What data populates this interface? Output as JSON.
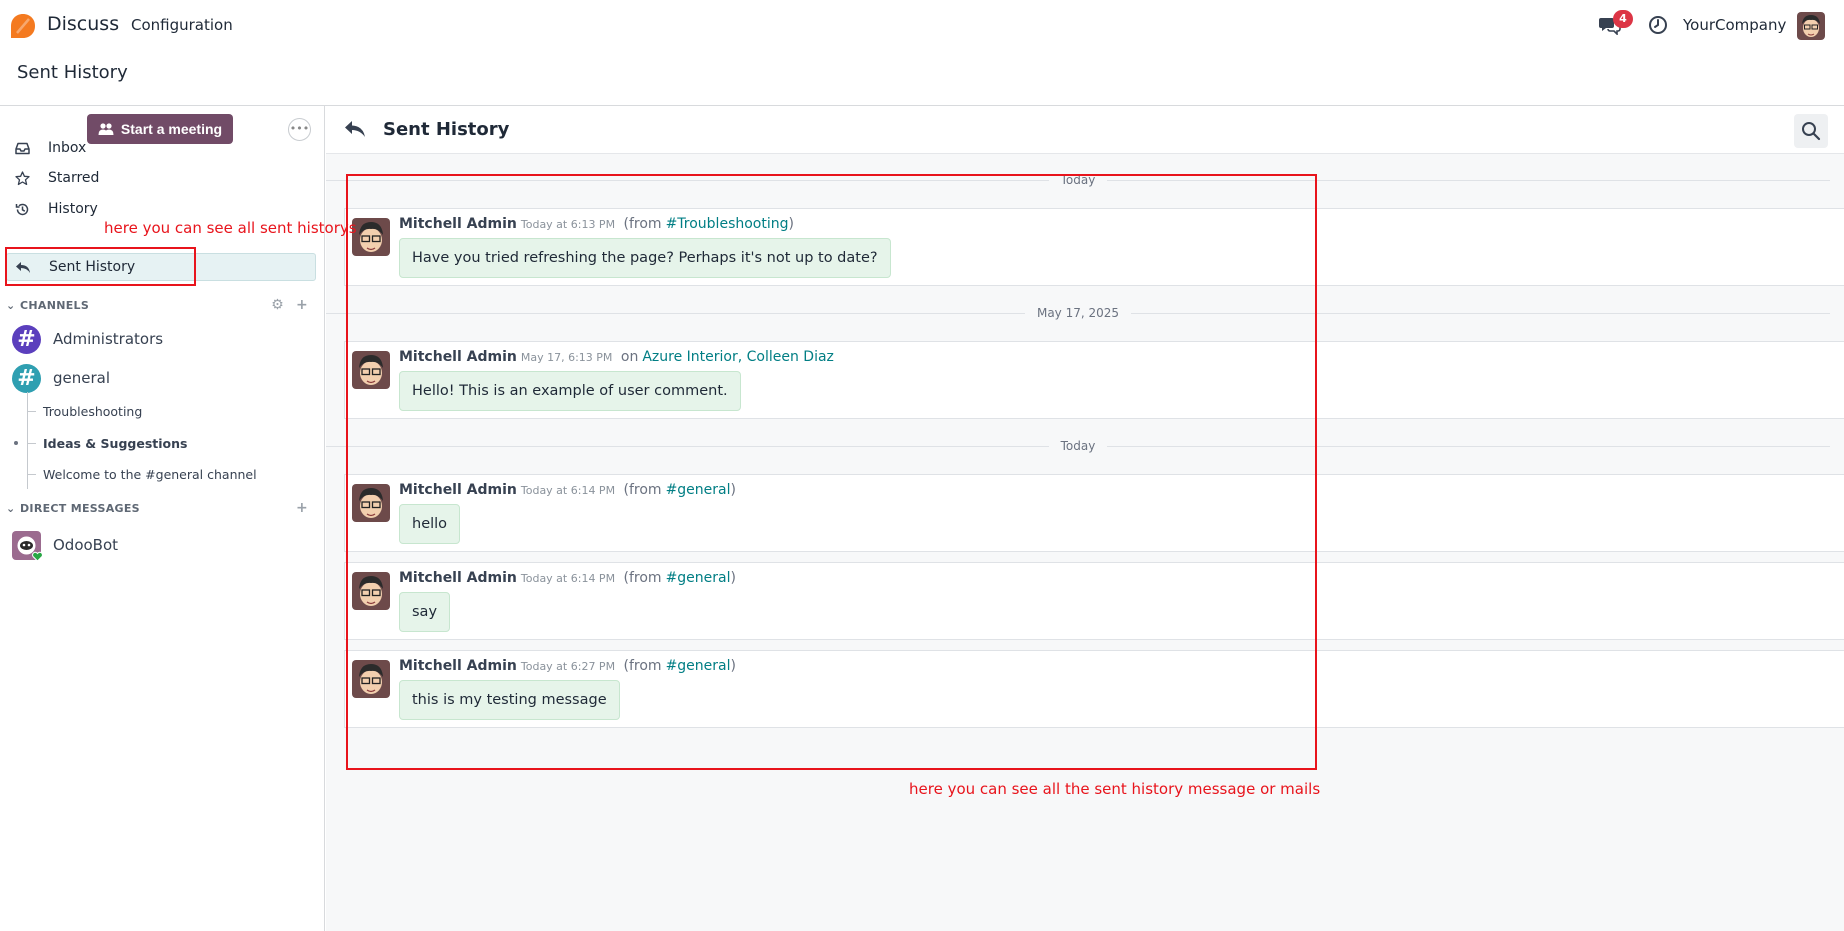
{
  "navbar": {
    "app_name": "Discuss",
    "menu_configuration": "Configuration",
    "chat_badge": "4",
    "company": "YourCompany"
  },
  "control_panel": {
    "title": "Sent History"
  },
  "sidebar": {
    "start_meeting": "Start a meeting",
    "items": [
      {
        "label": "Inbox",
        "icon": "inbox-icon"
      },
      {
        "label": "Starred",
        "icon": "star-icon"
      },
      {
        "label": "History",
        "icon": "history-icon"
      },
      {
        "label": "Sent History",
        "icon": "reply-icon",
        "active": true
      }
    ],
    "channels_header": "CHANNELS",
    "channels": [
      {
        "name": "Administrators",
        "color": "#5b3fbd"
      },
      {
        "name": "general",
        "color": "#2f9fb1"
      }
    ],
    "threads": [
      {
        "name": "Troubleshooting"
      },
      {
        "name": "Ideas & Suggestions",
        "bold": true
      },
      {
        "name": "Welcome to the #general channel"
      }
    ],
    "dm_header": "DIRECT MESSAGES",
    "dms": [
      {
        "name": "OdooBot"
      }
    ]
  },
  "main": {
    "title": "Sent History",
    "separators": [
      "Today",
      "May 17, 2025",
      "Today"
    ],
    "messages": [
      {
        "author": "Mitchell Admin",
        "time": "Today at 6:13 PM",
        "from_prefix": "(from",
        "from_link": "#Troubleshooting",
        "from_suffix": ")",
        "body": "Have you tried refreshing the page? Perhaps it's not up to date?"
      },
      {
        "author": "Mitchell Admin",
        "time": "May 17, 6:13 PM",
        "from_prefix": "on",
        "from_link": "Azure Interior, Colleen Diaz",
        "from_suffix": "",
        "body": "Hello! This is an example of user comment."
      },
      {
        "author": "Mitchell Admin",
        "time": "Today at 6:14 PM",
        "from_prefix": "(from",
        "from_link": "#general",
        "from_suffix": ")",
        "body": "hello"
      },
      {
        "author": "Mitchell Admin",
        "time": "Today at 6:14 PM",
        "from_prefix": "(from",
        "from_link": "#general",
        "from_suffix": ")",
        "body": "say"
      },
      {
        "author": "Mitchell Admin",
        "time": "Today at 6:27 PM",
        "from_prefix": "(from",
        "from_link": "#general",
        "from_suffix": ")",
        "body": "this is my testing message"
      }
    ]
  },
  "annotations": {
    "sidebar_note": "here you can see all sent historys",
    "main_note": "here you can see all the sent history message or mails"
  },
  "colors": {
    "brand": "#714b67",
    "link": "#017e84",
    "annotation": "#e8141c",
    "badge": "#dc3545"
  }
}
